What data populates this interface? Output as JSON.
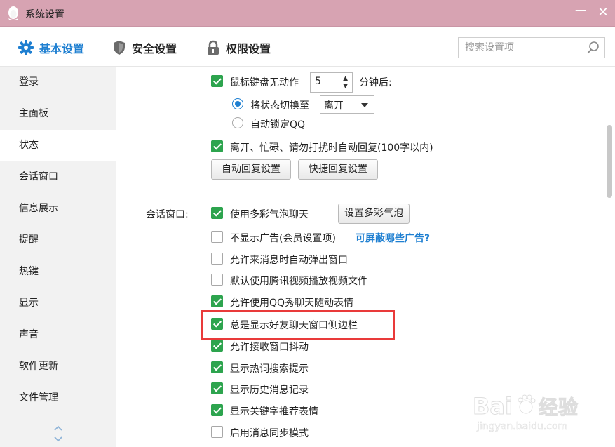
{
  "window": {
    "title": "系统设置",
    "minimize_label": "－",
    "close_label": "✕"
  },
  "tabs": [
    {
      "label": "基本设置",
      "icon": "gear-icon",
      "active": true
    },
    {
      "label": "安全设置",
      "icon": "shield-icon",
      "active": false
    },
    {
      "label": "权限设置",
      "icon": "lock-icon",
      "active": false
    }
  ],
  "search": {
    "placeholder": "搜索设置项",
    "value": ""
  },
  "sidebar": {
    "items": [
      {
        "label": "登录"
      },
      {
        "label": "主面板"
      },
      {
        "label": "状态",
        "active": true
      },
      {
        "label": "会话窗口"
      },
      {
        "label": "信息展示"
      },
      {
        "label": "提醒"
      },
      {
        "label": "热键"
      },
      {
        "label": "显示"
      },
      {
        "label": "声音"
      },
      {
        "label": "软件更新"
      },
      {
        "label": "文件管理"
      }
    ]
  },
  "status": {
    "idle_checkbox_label": "鼠标键盘无动作",
    "idle_checked": true,
    "idle_minutes": "5",
    "idle_suffix": "分钟后:",
    "switch_radio_label": "将状态切换至",
    "switch_value": "离开",
    "lock_radio_label": "自动锁定QQ",
    "auto_reply_label": "离开、忙碌、请勿打扰时自动回复(100字以内)",
    "auto_reply_checked": true,
    "auto_reply_btn": "自动回复设置",
    "quick_reply_btn": "快捷回复设置"
  },
  "chat_window": {
    "section_label": "会话窗口:",
    "bubble_btn": "设置多彩气泡",
    "ad_link": "可屏蔽哪些广告?",
    "options": [
      {
        "label": "使用多彩气泡聊天",
        "checked": true
      },
      {
        "label": "不显示广告(会员设置项)",
        "checked": false
      },
      {
        "label": "允许来消息时自动弹出窗口",
        "checked": false
      },
      {
        "label": "默认使用腾讯视频播放视频文件",
        "checked": false
      },
      {
        "label": "允许使用QQ秀聊天随动表情",
        "checked": true
      },
      {
        "label": "总是显示好友聊天窗口侧边栏",
        "checked": true
      },
      {
        "label": "允许接收窗口抖动",
        "checked": true
      },
      {
        "label": "显示热词搜索提示",
        "checked": true
      },
      {
        "label": "显示历史消息记录",
        "checked": true
      },
      {
        "label": "显示关键字推荐表情",
        "checked": true
      },
      {
        "label": "启用消息同步模式",
        "checked": false
      }
    ]
  },
  "watermark": {
    "brand": "Baidu经验",
    "url": "jingyan.baidu.com"
  },
  "colors": {
    "titlebar": "#d7a3b2",
    "accent": "#1e7fd1",
    "check": "#2da44e",
    "highlight": "#e93a3a"
  }
}
